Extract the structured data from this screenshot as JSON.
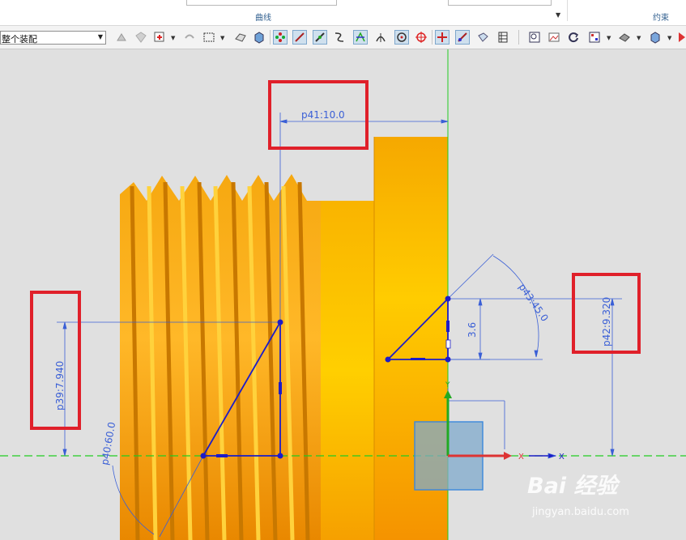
{
  "ribbon": {
    "group_curve": "曲线",
    "group_constraint": "约束"
  },
  "toolbar": {
    "selection_filter": "整个装配"
  },
  "sketch": {
    "dimensions": {
      "p41": "p41:10.0",
      "p39": "p39:7.940",
      "p40": "p40:60.0",
      "p43": "p43:45.0",
      "p42": "p42:9.320",
      "d36": "3.6"
    },
    "axis_x": "X",
    "axis_y": "Y"
  },
  "watermark": {
    "brand": "Bai 经验",
    "url": "jingyan.baidu.com"
  },
  "colors": {
    "highlight_box": "#e0202a",
    "dimension": "#3a5fd6",
    "sketch_curve": "#1c1cc8",
    "grid_axis": "#22cc22",
    "part_orange": "#f39a00",
    "viewport_bg": "#e0e0e0"
  }
}
